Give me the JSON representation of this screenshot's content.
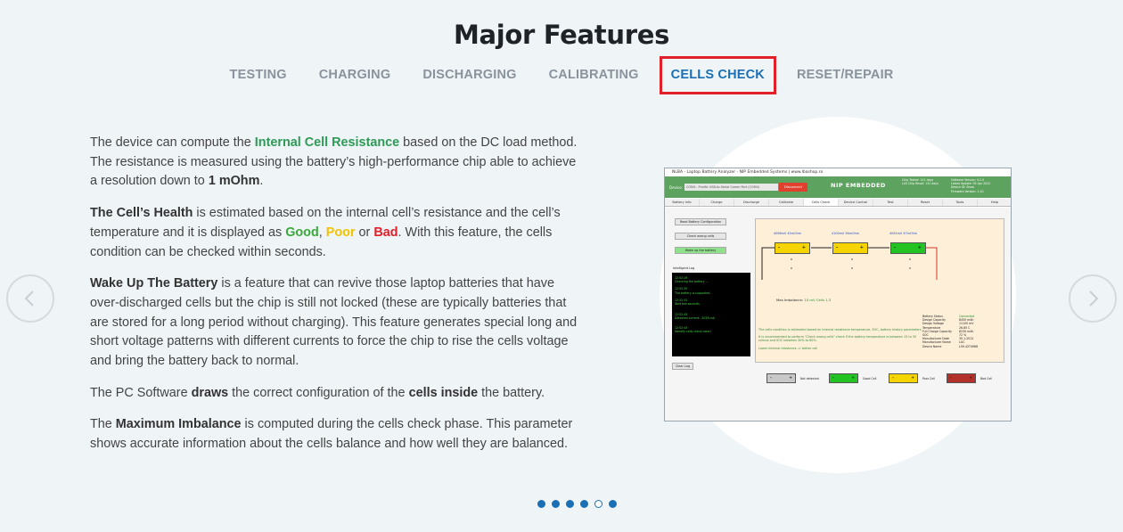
{
  "page": {
    "title": "Major Features"
  },
  "tabs": [
    {
      "label": "TESTING"
    },
    {
      "label": "CHARGING"
    },
    {
      "label": "DISCHARGING"
    },
    {
      "label": "CALIBRATING"
    },
    {
      "label": "CELLS CHECK"
    },
    {
      "label": "RESET/REPAIR"
    }
  ],
  "active_tab": "CELLS CHECK",
  "content": {
    "p1": {
      "a": "The device can compute the ",
      "b": "Internal Cell Resistance",
      "c": " based on the DC load method. The resistance is measured using the battery’s high-performance chip able to achieve a resolution down to ",
      "d": "1 mOhm",
      "e": "."
    },
    "p2": {
      "a": "The Cell’s Health",
      "b": " is estimated based on the internal cell’s resistance and the cell’s temperature and it is displayed as ",
      "good": "Good",
      "c": ", ",
      "poor": "Poor",
      "d": " or ",
      "bad": "Bad",
      "e": ". With this feature, the cells condition can be checked within seconds."
    },
    "p3": {
      "a": "Wake Up The Battery",
      "b": " is a feature that can revive those laptop batteries that have over-discharged cells but the chip is still not locked (these are typically batteries that are stored for a long period without charging). This feature generates special long and short voltage patterns with different currents to force the chip to rise the cells voltage and bring the battery back to normal."
    },
    "p4": {
      "a": "The PC Software ",
      "b": "draws",
      "c": " the correct configuration of the ",
      "d": "cells inside",
      "e": " the battery."
    },
    "p5": {
      "a": "The ",
      "b": "Maximum Imbalance",
      "c": " is computed during the cells check phase. This parameter shows accurate information about the cells balance and how well they are balanced."
    }
  },
  "app": {
    "window_title": "NLBA - Laptop Battery Analyzer - NIP Embedded Systems | www.lbashop.ro",
    "device_label": "Device:",
    "device_value": "COM4 - Prolific USB-to-Serial Comm Port (COM4)",
    "disconnect": "Disconnect",
    "logo": "NIP EMBEDDED",
    "info_left": [
      "Chip Tested: 141 days",
      "LLD Chip Reset: 141 days"
    ],
    "info_right": [
      "Software Version: 4.2.0",
      "Latest Update: 05 Apr 2022",
      "Device ID: Show",
      "Firmware Version: 1.10"
    ],
    "tabs": [
      "Battery Info",
      "Charge",
      "Discharge",
      "Calibrate",
      "Cells Check",
      "Device Control",
      "Test",
      "Reset",
      "Tools",
      "Help"
    ],
    "buttons": {
      "read_config": "Read Battery Configuration",
      "check_cells": "Check wrong cells",
      "wake_up": "Wake up the battery",
      "clear_log": "Clear Log"
    },
    "log_label": "Intelligent Log",
    "log_lines": [
      "12:52:29",
      "Checking the battery ...",
      "12:52:30",
      "The battery is supported.",
      "12:52:31",
      "Wait few seconds",
      "12:52:43",
      "Detected current: -2026 mA",
      "12:52:43",
      "Identify cells check done!"
    ],
    "cells": [
      {
        "label": "4066mV  45mOhm",
        "minus": "-",
        "plus": "+"
      },
      {
        "label": "4100mV  56mOhm",
        "minus": "-",
        "plus": "+"
      },
      {
        "label": "4061mV  47mOhm",
        "minus": "-",
        "plus": "+"
      }
    ],
    "max_imbalance_label": "Max Imbalance:",
    "max_imbalance_value": "10 mV Cells 1-3",
    "notes": [
      "The cells condition is estimated based on internal resistance temperature, SOC, battery history parameters",
      "It is recommended to perform \"Check wrong cells\" check if the battery temperature is between 15 to 30 celsius and SOC between 30% to 80%.",
      "Lower internal resistance -> better cell"
    ],
    "status_labels": [
      "Battery Status",
      "Design Capacity",
      "Design Voltage",
      "Temperature",
      "Full Charge Capacity",
      "SOC",
      "Manufacturer Date",
      "Manufacturer Name",
      "Device Name"
    ],
    "status_values": [
      "Connected",
      "8450 mAh",
      "11100 mV",
      "26.85 C",
      "6230 mAh",
      "72 %",
      "30.1.2012",
      "LGC",
      "L09-42T4968"
    ],
    "legend": [
      {
        "label": "Not detected",
        "color": "#c8c8c8"
      },
      {
        "label": "Good Cell",
        "color": "#22c322"
      },
      {
        "label": "Poor Cell",
        "color": "#f5d400"
      },
      {
        "label": "Bad Cell",
        "color": "#b3302b"
      }
    ]
  },
  "carousel": {
    "dots": 6,
    "active_index": 4
  }
}
